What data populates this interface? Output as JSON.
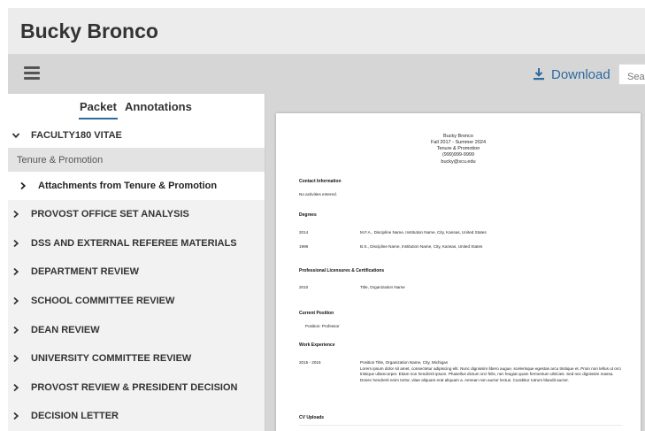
{
  "header": {
    "title": "Bucky Bronco"
  },
  "toolbar": {
    "menu_icon": "hamburger-menu-icon",
    "download_label": "Download",
    "download_icon": "download-icon",
    "search_placeholder": "Search",
    "accent_color": "#2c6aa0"
  },
  "sidebar": {
    "tabs": [
      {
        "label": "Packet",
        "active": true
      },
      {
        "label": "Annotations",
        "active": false
      }
    ],
    "faculty_section": "FACULTY180 VITAE",
    "tenure_label": "Tenure & Promotion",
    "attachments_label": "Attachments from Tenure & Promotion",
    "items": [
      {
        "label": "PROVOST OFFICE SET ANALYSIS"
      },
      {
        "label": "DSS AND EXTERNAL REFEREE MATERIALS"
      },
      {
        "label": "DEPARTMENT REVIEW"
      },
      {
        "label": "SCHOOL COMMITTEE REVIEW"
      },
      {
        "label": "DEAN REVIEW"
      },
      {
        "label": "UNIVERSITY COMMITTEE REVIEW"
      },
      {
        "label": "PROVOST REVIEW & PRESIDENT DECISION"
      },
      {
        "label": "DECISION LETTER"
      }
    ]
  },
  "document": {
    "name": "Bucky Bronco",
    "term": "Fall 2017 - Summer 2024",
    "category": "Tenure & Promotion",
    "phone": "(999)999-9999",
    "email": "bucky@scu.edu",
    "contact": {
      "heading": "Contact Information",
      "text": "No activities entered."
    },
    "degrees": {
      "heading": "Degrees",
      "rows": [
        {
          "year": "2014",
          "desc": "M.F.A., Discipline Name, Institution Name, City, Kansas, United States"
        },
        {
          "year": "1996",
          "desc": "B.S., Discipline Name, Institution Name, City, Kansas, United States"
        }
      ]
    },
    "licensures": {
      "heading": "Professional Licensures & Certifications",
      "year": "2010",
      "desc": "Title, Organization Name"
    },
    "current_position": {
      "heading": "Current Position",
      "text": "Position: Professor"
    },
    "work": {
      "heading": "Work Experience",
      "years": "2015 - 2016",
      "title": "Position Title, Organization Name, City, Michigan",
      "body": "Lorem ipsum dolor sit amet, consectetur adipiscing elit. Nunc dignissim libero augue, scelerisque egestas arcu tristique et. Proin non tellus ut orci tristique ullamcorper. Etiam non hendrerit ipsum. Phasellus dictum orci felis, nec feugiat quam fermentum ultricies. Sed nec dignissim massa. Donec hendrerit enim tortor, vitae aliquam erat aliquam a. Aenean non auctor lectus. Curabitur rutrum blandit auctor."
    },
    "cv_uploads": {
      "heading": "CV Uploads"
    }
  }
}
